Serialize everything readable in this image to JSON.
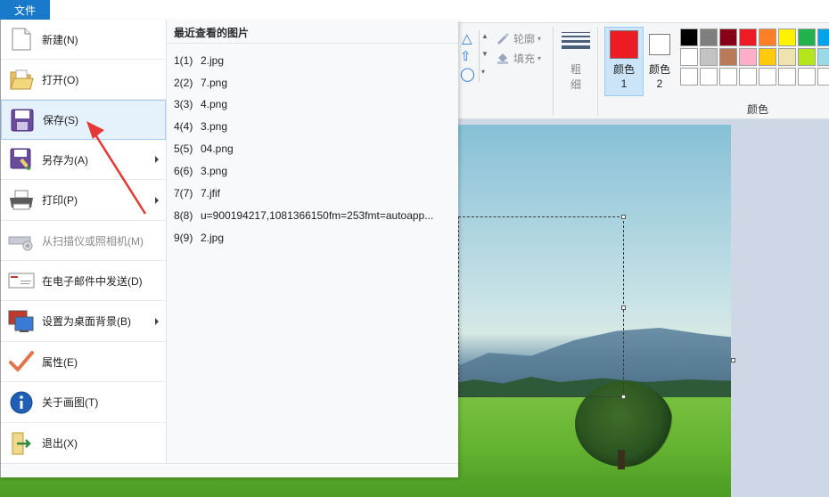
{
  "file_tab": "文件",
  "menu": {
    "items": [
      {
        "label": "新建(N)",
        "icon": "new-document-icon"
      },
      {
        "label": "打开(O)",
        "icon": "open-folder-icon"
      },
      {
        "label": "保存(S)",
        "icon": "floppy-disk-icon"
      },
      {
        "label": "另存为(A)",
        "icon": "save-as-icon"
      },
      {
        "label": "打印(P)",
        "icon": "printer-icon"
      },
      {
        "label": "从扫描仪或照相机(M)",
        "icon": "scanner-icon"
      },
      {
        "label": "在电子邮件中发送(D)",
        "icon": "email-icon"
      },
      {
        "label": "设置为桌面背景(B)",
        "icon": "desktop-icon"
      },
      {
        "label": "属性(E)",
        "icon": "checkmark-icon"
      },
      {
        "label": "关于画图(T)",
        "icon": "info-icon"
      },
      {
        "label": "退出(X)",
        "icon": "exit-icon"
      }
    ],
    "recent_title": "最近查看的图片",
    "recent": [
      {
        "num": "1(1)",
        "name": "2.jpg"
      },
      {
        "num": "2(2)",
        "name": "7.png"
      },
      {
        "num": "3(3)",
        "name": "4.png"
      },
      {
        "num": "4(4)",
        "name": "3.png"
      },
      {
        "num": "5(5)",
        "name": "04.png"
      },
      {
        "num": "6(6)",
        "name": "3.png"
      },
      {
        "num": "7(7)",
        "name": "7.jfif"
      },
      {
        "num": "8(8)",
        "name": "u=900194217,1081366150fm=253fmt=autoapp..."
      },
      {
        "num": "9(9)",
        "name": "2.jpg"
      }
    ]
  },
  "ribbon": {
    "outline_label": "轮廓",
    "fill_label": "填充",
    "size_label": "粗细",
    "color1_label": "颜色 1",
    "color2_label": "颜色 2",
    "colors_group_label": "颜色",
    "color1": "#ed1c24",
    "color2": "#ffffff",
    "palette_row1": [
      "#000000",
      "#7f7f7f",
      "#880015",
      "#ed1c24",
      "#ff7f27",
      "#fff200",
      "#22b14c",
      "#00a2e8"
    ],
    "palette_row2": [
      "#ffffff",
      "#c3c3c3",
      "#b97a57",
      "#ffaec9",
      "#ffc90e",
      "#efe4b0",
      "#b5e61d",
      "#99d9ea"
    ]
  }
}
